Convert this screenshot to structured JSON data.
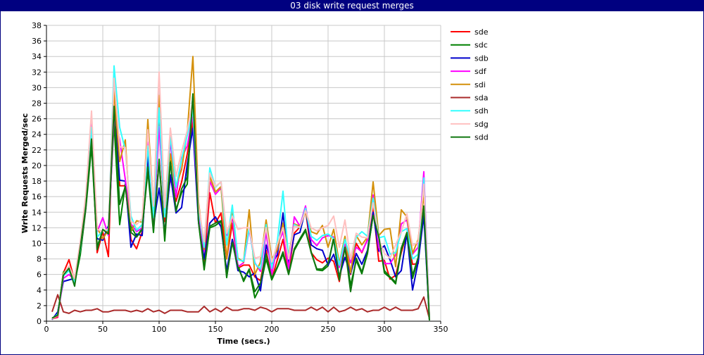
{
  "window": {
    "title": "03 disk write request merges"
  },
  "chart_data": {
    "type": "line",
    "title": "03 disk write request merges",
    "xlabel": "Time (secs.)",
    "ylabel": "Write Requests Merged/sec",
    "xlim": [
      0,
      350
    ],
    "ylim": [
      0,
      38
    ],
    "xticks": [
      0,
      50,
      100,
      150,
      200,
      250,
      300,
      350
    ],
    "yticks": [
      0,
      2,
      4,
      6,
      8,
      10,
      12,
      14,
      16,
      18,
      20,
      22,
      24,
      26,
      28,
      30,
      32,
      34,
      36,
      38
    ],
    "grid": true,
    "legend_position": "right",
    "x": [
      5,
      10,
      15,
      20,
      25,
      30,
      35,
      40,
      45,
      50,
      55,
      60,
      65,
      70,
      75,
      80,
      85,
      90,
      95,
      100,
      105,
      110,
      115,
      120,
      125,
      130,
      135,
      140,
      145,
      150,
      155,
      160,
      165,
      170,
      175,
      180,
      185,
      190,
      195,
      200,
      205,
      210,
      215,
      220,
      225,
      230,
      235,
      240,
      245,
      250,
      255,
      260,
      265,
      270,
      275,
      280,
      285,
      290,
      295,
      300,
      305,
      310,
      315,
      320,
      325,
      330,
      335,
      340
    ],
    "series": [
      {
        "name": "sde",
        "color": "#ff0000",
        "values": [
          0.3,
          0.5,
          6.2,
          7.9,
          5.2,
          9.5,
          15,
          24,
          8.8,
          11.5,
          8.3,
          30.3,
          17.4,
          17.4,
          10.5,
          9.3,
          11.5,
          20.5,
          11.7,
          26.3,
          12.8,
          18.4,
          15.4,
          17.9,
          21.5,
          25.7,
          13.7,
          7.5,
          16.5,
          12.6,
          13.9,
          8.0,
          12.6,
          6.8,
          7.2,
          7.2,
          5.7,
          5.2,
          9.1,
          5.4,
          7.9,
          10.5,
          6.3,
          11.3,
          12.1,
          14.3,
          8.8,
          7.9,
          7.5,
          8.1,
          7.7,
          5.1,
          9.7,
          6.0,
          10.0,
          8.8,
          10.5,
          14.7,
          7.7,
          7.8,
          5.4,
          5.9,
          8.8,
          11.3,
          7.3,
          7.4,
          17.7,
          0.2
        ]
      },
      {
        "name": "sdc",
        "color": "#008000",
        "values": [
          0.4,
          0.8,
          6.3,
          6.6,
          4.9,
          8.5,
          14.5,
          22.5,
          9.6,
          11.6,
          11.8,
          25.5,
          12.4,
          17.6,
          12.2,
          10.9,
          11.9,
          19.3,
          11.4,
          20.8,
          10.3,
          20.6,
          14.3,
          16.5,
          17.6,
          29.2,
          12.7,
          6.6,
          12.0,
          12.3,
          12.8,
          5.6,
          10.5,
          7.2,
          5.1,
          6.6,
          3.0,
          4.5,
          8.0,
          5.3,
          6.9,
          8.6,
          6.0,
          9.1,
          10.4,
          11.6,
          8.9,
          6.6,
          6.5,
          7.1,
          10.8,
          5.3,
          9.5,
          4.6,
          7.8,
          6.1,
          8.7,
          13.7,
          11.0,
          6.2,
          5.6,
          4.8,
          9.2,
          11.1,
          5.5,
          8.0,
          14.3,
          0.1
        ]
      },
      {
        "name": "sdb",
        "color": "#0000cc",
        "values": [
          0.2,
          1.2,
          5.1,
          5.3,
          5.5,
          9.8,
          16.0,
          23.8,
          10.6,
          10.4,
          12.3,
          27.4,
          18.1,
          18.0,
          9.5,
          11.2,
          11.0,
          21.5,
          12.4,
          17.1,
          11.4,
          18.8,
          13.9,
          14.6,
          20.2,
          24.8,
          12.7,
          8.0,
          12.6,
          13.4,
          12.1,
          6.5,
          10.5,
          6.5,
          6.3,
          5.7,
          6.2,
          3.9,
          9.8,
          7.4,
          8.5,
          13.9,
          7.3,
          11.1,
          11.4,
          14.4,
          9.8,
          9.3,
          9.1,
          7.2,
          8.6,
          5.8,
          8.2,
          6.1,
          8.7,
          7.3,
          9.1,
          14.0,
          9.0,
          9.7,
          7.9,
          5.7,
          6.5,
          11.3,
          4.0,
          7.6,
          13.6,
          0.2
        ]
      },
      {
        "name": "sdf",
        "color": "#ff00ff",
        "values": [
          0.3,
          0.6,
          5.5,
          6.0,
          5.3,
          9.3,
          14.8,
          25.8,
          11.5,
          13.3,
          11.0,
          26.5,
          23.3,
          18.2,
          12.5,
          11.5,
          12.0,
          23.0,
          13.0,
          25.0,
          14.5,
          23.1,
          16.0,
          21.0,
          22.5,
          26.5,
          13.6,
          9.0,
          18.0,
          16.3,
          17.1,
          11.0,
          13.3,
          7.0,
          7.5,
          11.8,
          7.5,
          6.4,
          11.4,
          6.0,
          9.7,
          11.5,
          6.7,
          13.4,
          12.2,
          14.8,
          10.5,
          9.7,
          10.7,
          11.0,
          10.8,
          6.9,
          9.9,
          7.5,
          9.5,
          8.9,
          10.4,
          16.2,
          9.5,
          7.4,
          7.4,
          8.5,
          12.5,
          13.0,
          8.6,
          9.5,
          19.2,
          0.2
        ]
      },
      {
        "name": "sdi",
        "color": "#d4900a",
        "values": [
          0.3,
          0.7,
          6.2,
          6.6,
          5.4,
          10.0,
          15.8,
          24.7,
          12.0,
          10.6,
          11.7,
          29.7,
          20.5,
          23.3,
          11.5,
          12.9,
          12.7,
          25.9,
          14.6,
          29.0,
          13.7,
          21.5,
          17.4,
          19.5,
          24.3,
          34.0,
          15.3,
          9.2,
          18.6,
          16.6,
          17.3,
          8.0,
          14.3,
          8.1,
          7.6,
          14.3,
          6.0,
          7.6,
          13.0,
          8.0,
          9.2,
          12.6,
          8.3,
          12.5,
          12.2,
          14.0,
          11.5,
          11.2,
          12.3,
          9.5,
          11.8,
          7.4,
          10.9,
          6.2,
          11.0,
          9.8,
          10.8,
          17.9,
          11.0,
          11.8,
          11.9,
          7.0,
          14.3,
          13.4,
          8.7,
          10.5,
          16.3,
          0.2
        ]
      },
      {
        "name": "sda",
        "color": "#aa2a2a",
        "values": [
          1.2,
          3.4,
          1.2,
          1.0,
          1.4,
          1.2,
          1.4,
          1.4,
          1.6,
          1.2,
          1.2,
          1.4,
          1.4,
          1.4,
          1.2,
          1.4,
          1.2,
          1.6,
          1.2,
          1.4,
          1.0,
          1.4,
          1.4,
          1.4,
          1.2,
          1.2,
          1.2,
          1.9,
          1.2,
          1.6,
          1.2,
          1.8,
          1.4,
          1.4,
          1.6,
          1.6,
          1.4,
          1.8,
          1.6,
          1.2,
          1.6,
          1.6,
          1.6,
          1.4,
          1.4,
          1.4,
          1.8,
          1.4,
          1.8,
          1.2,
          1.8,
          1.2,
          1.4,
          1.8,
          1.4,
          1.6,
          1.2,
          1.4,
          1.4,
          1.8,
          1.4,
          1.8,
          1.4,
          1.4,
          1.4,
          1.6,
          3.1,
          0.3
        ]
      },
      {
        "name": "sdh",
        "color": "#33ffff",
        "values": [
          0.3,
          0.9,
          5.8,
          6.5,
          5.0,
          9.2,
          15.4,
          24.9,
          10.8,
          11.6,
          11.7,
          32.8,
          24.9,
          22.0,
          13.5,
          11.7,
          12.4,
          22.5,
          13.3,
          27.4,
          13.4,
          23.8,
          17.2,
          20.8,
          23.9,
          27.0,
          14.5,
          9.5,
          19.7,
          17.2,
          17.9,
          9.8,
          14.9,
          7.9,
          7.7,
          12.0,
          7.4,
          6.7,
          12.4,
          6.8,
          10.3,
          16.7,
          8.0,
          12.4,
          12.0,
          14.5,
          10.9,
          10.4,
          11.0,
          11.2,
          10.6,
          7.2,
          10.5,
          8.0,
          10.8,
          11.5,
          10.9,
          15.8,
          10.7,
          10.9,
          8.6,
          8.8,
          11.5,
          11.9,
          8.0,
          8.6,
          18.4,
          0.2
        ]
      },
      {
        "name": "sdg",
        "color": "#ffc0c0",
        "values": [
          0.3,
          0.8,
          6.0,
          7.1,
          5.5,
          10.2,
          16.3,
          27.0,
          11.8,
          11.5,
          11.9,
          31.2,
          22.4,
          22.3,
          12.8,
          12.4,
          13.2,
          24.6,
          14.8,
          32.0,
          14.6,
          24.8,
          18.6,
          21.8,
          24.5,
          28.4,
          14.8,
          10.2,
          19.0,
          17.3,
          17.9,
          11.3,
          13.5,
          11.8,
          12.0,
          12.0,
          8.1,
          8.3,
          12.0,
          7.6,
          9.9,
          12.0,
          8.0,
          12.2,
          12.1,
          14.2,
          12.0,
          11.6,
          12.0,
          12.3,
          13.5,
          9.5,
          13.0,
          8.0,
          11.3,
          10.8,
          10.7,
          15.2,
          10.5,
          8.7,
          8.1,
          9.8,
          11.5,
          13.8,
          9.7,
          10.2,
          17.6,
          0.2
        ]
      },
      {
        "name": "sdd",
        "color": "#117711",
        "values": [
          0.4,
          0.8,
          5.9,
          6.8,
          4.5,
          9.4,
          14.8,
          23.4,
          9.2,
          11.8,
          11.2,
          27.6,
          15.0,
          17.3,
          11.4,
          10.8,
          11.8,
          19.8,
          11.8,
          20.6,
          10.9,
          20.4,
          14.1,
          17.0,
          18.5,
          29.0,
          12.8,
          6.9,
          12.2,
          12.6,
          12.9,
          5.8,
          10.1,
          6.9,
          5.3,
          6.7,
          3.8,
          4.9,
          8.6,
          5.5,
          7.0,
          8.9,
          6.1,
          9.3,
          10.6,
          11.8,
          8.8,
          6.7,
          6.7,
          7.4,
          10.5,
          5.5,
          9.5,
          3.8,
          8.1,
          6.3,
          8.9,
          13.6,
          10.8,
          6.5,
          5.7,
          5.0,
          9.4,
          11.4,
          5.9,
          8.2,
          14.8,
          0.1
        ]
      }
    ]
  }
}
